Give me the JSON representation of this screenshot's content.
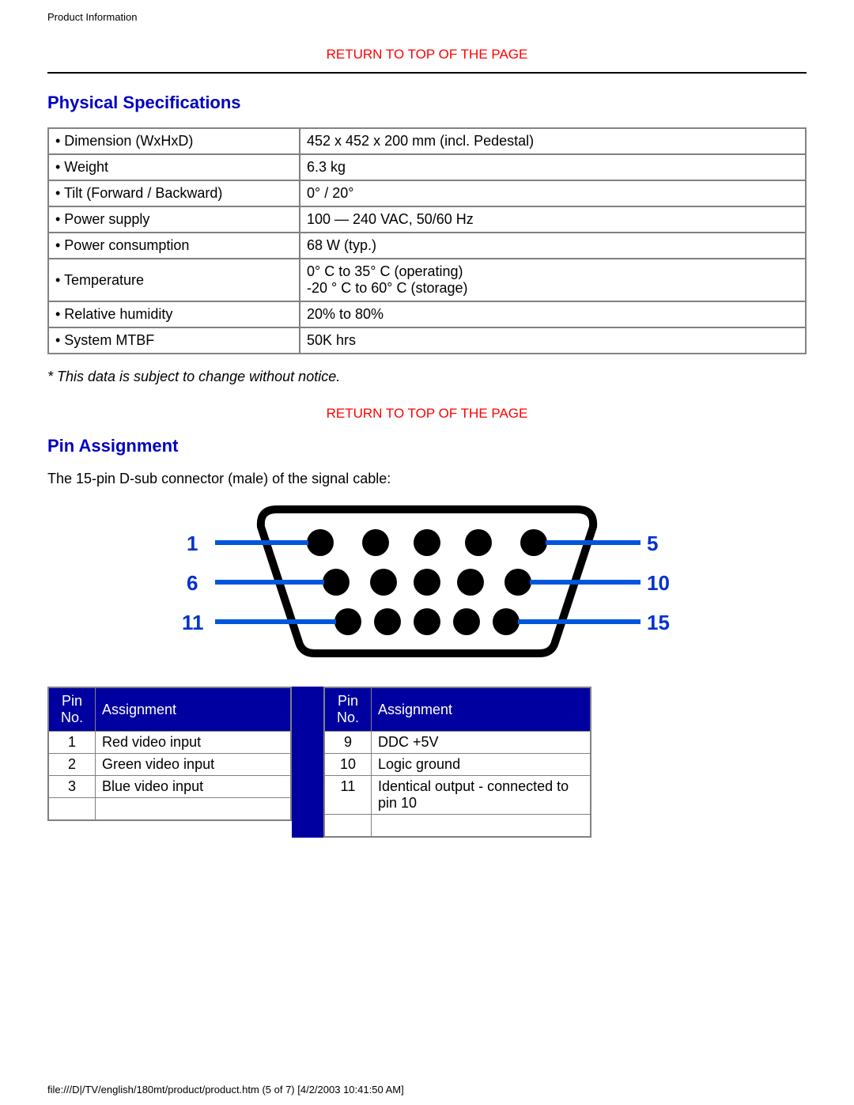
{
  "header": {
    "title": "Product Information"
  },
  "links": {
    "return_top": "RETURN TO TOP OF THE PAGE"
  },
  "physical": {
    "heading": "Physical Specifications",
    "rows": [
      {
        "label": "• Dimension (WxHxD)",
        "value": "452 x 452 x 200 mm (incl. Pedestal)"
      },
      {
        "label": "• Weight",
        "value": "6.3 kg"
      },
      {
        "label": "• Tilt (Forward / Backward)",
        "value": "0° / 20°"
      },
      {
        "label": "• Power supply",
        "value": "100 — 240 VAC, 50/60 Hz"
      },
      {
        "label": "• Power consumption",
        "value": "68 W (typ.)"
      },
      {
        "label": "• Temperature",
        "value": "0° C to 35° C (operating)\n-20 ° C to 60° C (storage)"
      },
      {
        "label": "• Relative humidity",
        "value": "20% to 80%"
      },
      {
        "label": "• System MTBF",
        "value": "50K hrs"
      }
    ],
    "footnote": "* This data is subject to change without notice."
  },
  "pin": {
    "heading": "Pin Assignment",
    "intro": "The 15-pin D-sub connector (male) of the signal cable:",
    "diagram_labels": {
      "l1": "1",
      "l2": "6",
      "l3": "11",
      "r1": "5",
      "r2": "10",
      "r3": "15"
    },
    "col_pin": "Pin No.",
    "col_asg": "Assignment",
    "left_rows": [
      {
        "no": "1",
        "asg": "Red video input"
      },
      {
        "no": "2",
        "asg": "Green video input"
      },
      {
        "no": "3",
        "asg": "Blue video input"
      }
    ],
    "right_rows": [
      {
        "no": "9",
        "asg": "DDC +5V"
      },
      {
        "no": "10",
        "asg": "Logic ground"
      },
      {
        "no": "11",
        "asg": "Identical output - connected to pin 10"
      }
    ]
  },
  "footer": {
    "path": "file:///D|/TV/english/180mt/product/product.htm (5 of 7) [4/2/2003 10:41:50 AM]"
  }
}
